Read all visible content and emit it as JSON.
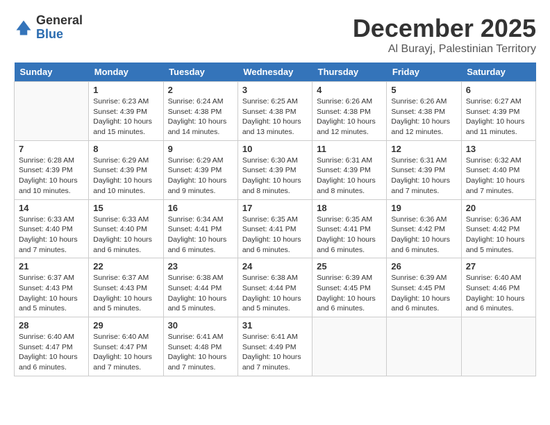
{
  "logo": {
    "general": "General",
    "blue": "Blue"
  },
  "title": "December 2025",
  "subtitle": "Al Burayj, Palestinian Territory",
  "days_of_week": [
    "Sunday",
    "Monday",
    "Tuesday",
    "Wednesday",
    "Thursday",
    "Friday",
    "Saturday"
  ],
  "weeks": [
    [
      {
        "day": "",
        "info": ""
      },
      {
        "day": "1",
        "info": "Sunrise: 6:23 AM\nSunset: 4:39 PM\nDaylight: 10 hours\nand 15 minutes."
      },
      {
        "day": "2",
        "info": "Sunrise: 6:24 AM\nSunset: 4:38 PM\nDaylight: 10 hours\nand 14 minutes."
      },
      {
        "day": "3",
        "info": "Sunrise: 6:25 AM\nSunset: 4:38 PM\nDaylight: 10 hours\nand 13 minutes."
      },
      {
        "day": "4",
        "info": "Sunrise: 6:26 AM\nSunset: 4:38 PM\nDaylight: 10 hours\nand 12 minutes."
      },
      {
        "day": "5",
        "info": "Sunrise: 6:26 AM\nSunset: 4:38 PM\nDaylight: 10 hours\nand 12 minutes."
      },
      {
        "day": "6",
        "info": "Sunrise: 6:27 AM\nSunset: 4:39 PM\nDaylight: 10 hours\nand 11 minutes."
      }
    ],
    [
      {
        "day": "7",
        "info": "Sunrise: 6:28 AM\nSunset: 4:39 PM\nDaylight: 10 hours\nand 10 minutes."
      },
      {
        "day": "8",
        "info": "Sunrise: 6:29 AM\nSunset: 4:39 PM\nDaylight: 10 hours\nand 10 minutes."
      },
      {
        "day": "9",
        "info": "Sunrise: 6:29 AM\nSunset: 4:39 PM\nDaylight: 10 hours\nand 9 minutes."
      },
      {
        "day": "10",
        "info": "Sunrise: 6:30 AM\nSunset: 4:39 PM\nDaylight: 10 hours\nand 8 minutes."
      },
      {
        "day": "11",
        "info": "Sunrise: 6:31 AM\nSunset: 4:39 PM\nDaylight: 10 hours\nand 8 minutes."
      },
      {
        "day": "12",
        "info": "Sunrise: 6:31 AM\nSunset: 4:39 PM\nDaylight: 10 hours\nand 7 minutes."
      },
      {
        "day": "13",
        "info": "Sunrise: 6:32 AM\nSunset: 4:40 PM\nDaylight: 10 hours\nand 7 minutes."
      }
    ],
    [
      {
        "day": "14",
        "info": "Sunrise: 6:33 AM\nSunset: 4:40 PM\nDaylight: 10 hours\nand 7 minutes."
      },
      {
        "day": "15",
        "info": "Sunrise: 6:33 AM\nSunset: 4:40 PM\nDaylight: 10 hours\nand 6 minutes."
      },
      {
        "day": "16",
        "info": "Sunrise: 6:34 AM\nSunset: 4:41 PM\nDaylight: 10 hours\nand 6 minutes."
      },
      {
        "day": "17",
        "info": "Sunrise: 6:35 AM\nSunset: 4:41 PM\nDaylight: 10 hours\nand 6 minutes."
      },
      {
        "day": "18",
        "info": "Sunrise: 6:35 AM\nSunset: 4:41 PM\nDaylight: 10 hours\nand 6 minutes."
      },
      {
        "day": "19",
        "info": "Sunrise: 6:36 AM\nSunset: 4:42 PM\nDaylight: 10 hours\nand 6 minutes."
      },
      {
        "day": "20",
        "info": "Sunrise: 6:36 AM\nSunset: 4:42 PM\nDaylight: 10 hours\nand 5 minutes."
      }
    ],
    [
      {
        "day": "21",
        "info": "Sunrise: 6:37 AM\nSunset: 4:43 PM\nDaylight: 10 hours\nand 5 minutes."
      },
      {
        "day": "22",
        "info": "Sunrise: 6:37 AM\nSunset: 4:43 PM\nDaylight: 10 hours\nand 5 minutes."
      },
      {
        "day": "23",
        "info": "Sunrise: 6:38 AM\nSunset: 4:44 PM\nDaylight: 10 hours\nand 5 minutes."
      },
      {
        "day": "24",
        "info": "Sunrise: 6:38 AM\nSunset: 4:44 PM\nDaylight: 10 hours\nand 5 minutes."
      },
      {
        "day": "25",
        "info": "Sunrise: 6:39 AM\nSunset: 4:45 PM\nDaylight: 10 hours\nand 6 minutes."
      },
      {
        "day": "26",
        "info": "Sunrise: 6:39 AM\nSunset: 4:45 PM\nDaylight: 10 hours\nand 6 minutes."
      },
      {
        "day": "27",
        "info": "Sunrise: 6:40 AM\nSunset: 4:46 PM\nDaylight: 10 hours\nand 6 minutes."
      }
    ],
    [
      {
        "day": "28",
        "info": "Sunrise: 6:40 AM\nSunset: 4:47 PM\nDaylight: 10 hours\nand 6 minutes."
      },
      {
        "day": "29",
        "info": "Sunrise: 6:40 AM\nSunset: 4:47 PM\nDaylight: 10 hours\nand 7 minutes."
      },
      {
        "day": "30",
        "info": "Sunrise: 6:41 AM\nSunset: 4:48 PM\nDaylight: 10 hours\nand 7 minutes."
      },
      {
        "day": "31",
        "info": "Sunrise: 6:41 AM\nSunset: 4:49 PM\nDaylight: 10 hours\nand 7 minutes."
      },
      {
        "day": "",
        "info": ""
      },
      {
        "day": "",
        "info": ""
      },
      {
        "day": "",
        "info": ""
      }
    ]
  ]
}
